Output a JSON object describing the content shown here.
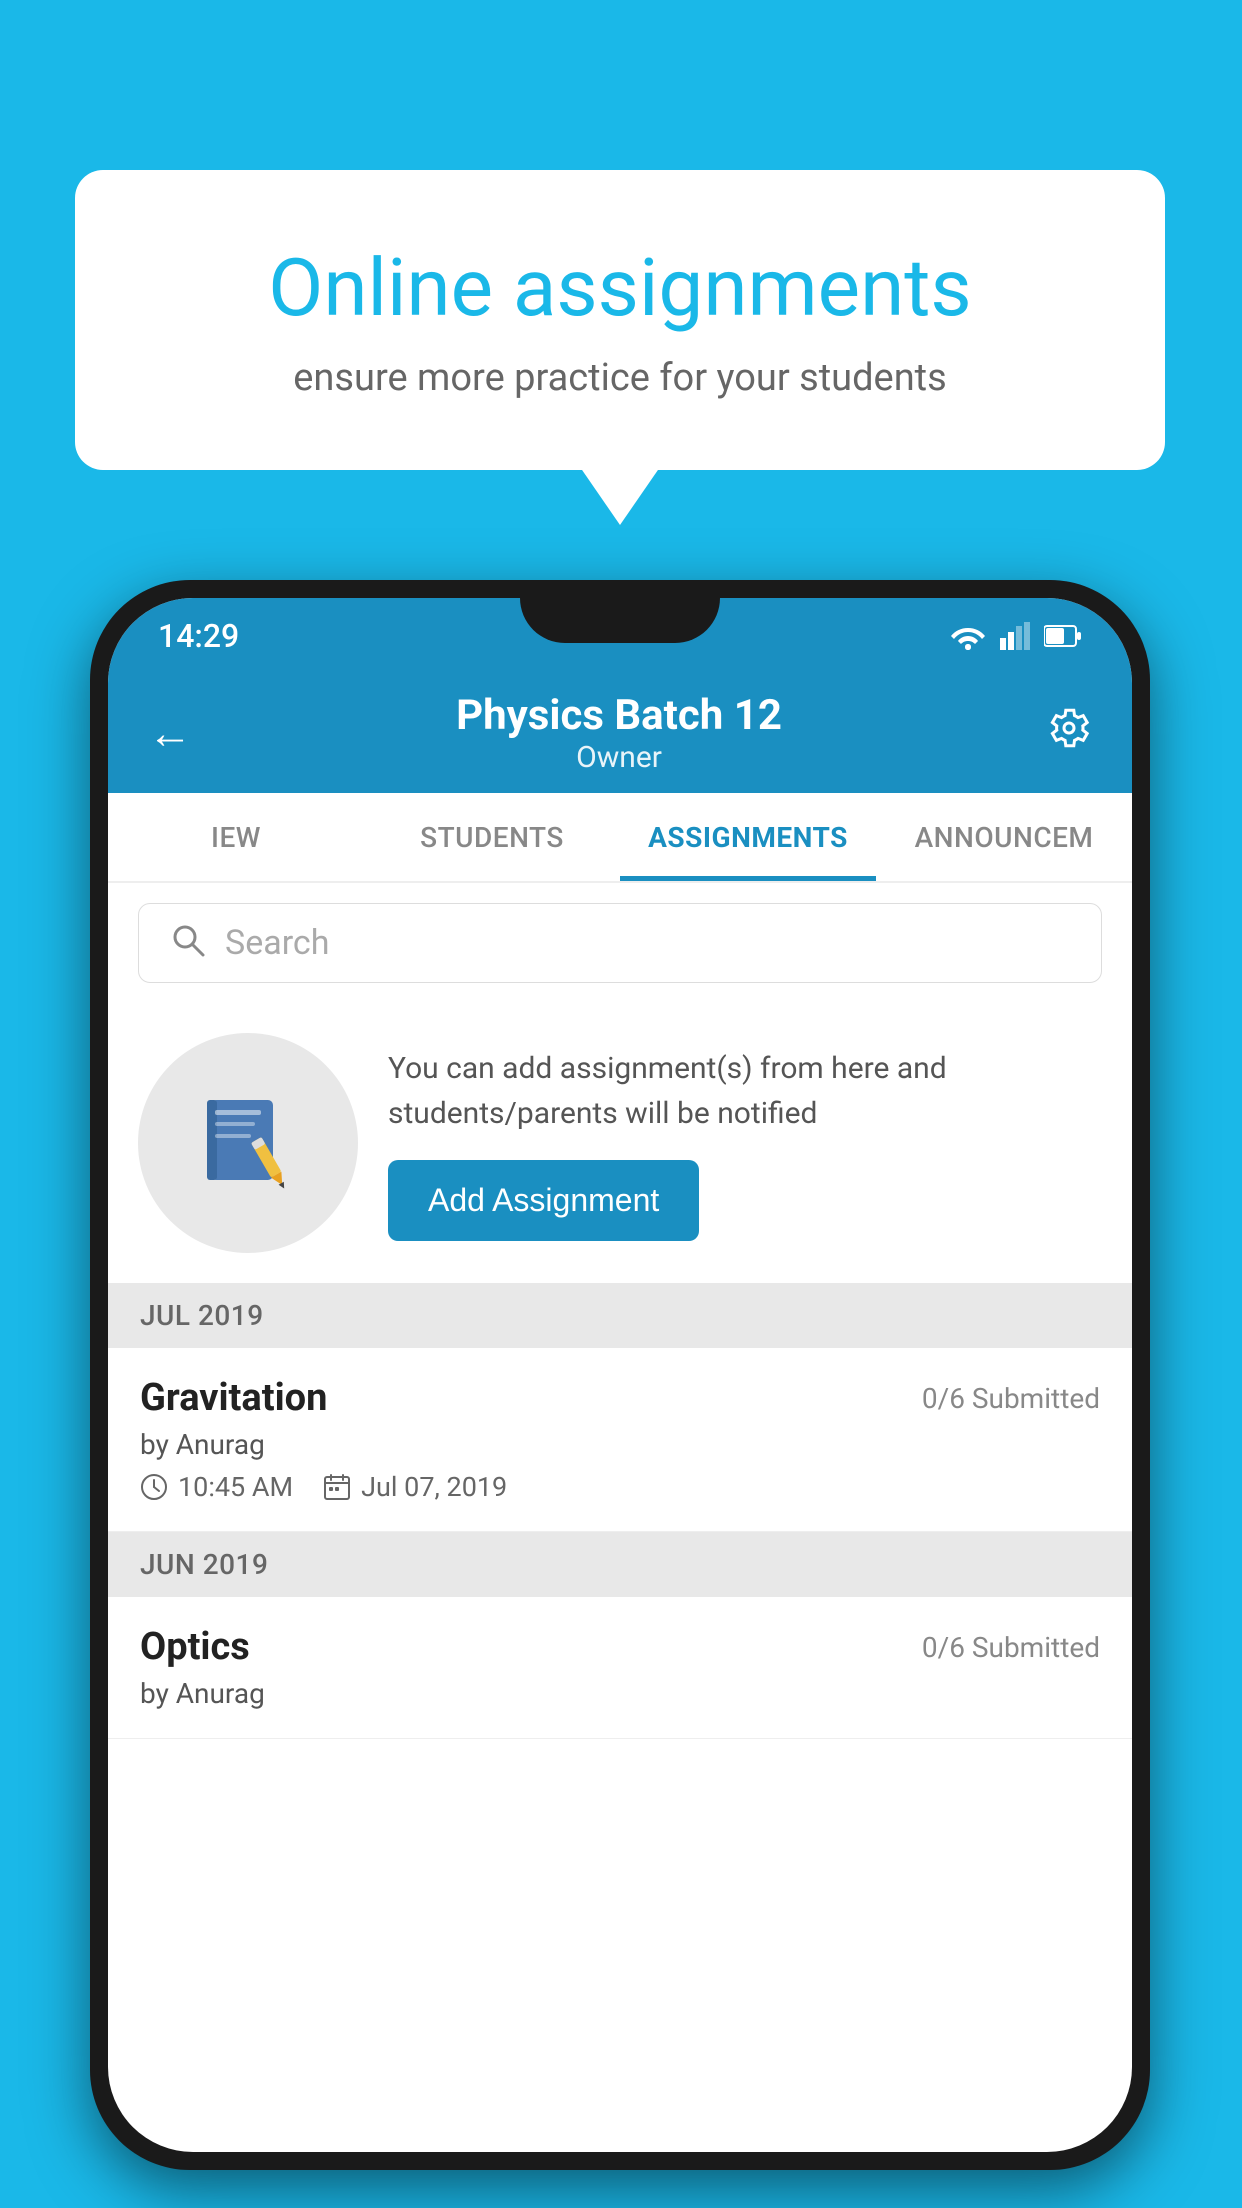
{
  "background_color": "#1ab8e8",
  "speech_bubble": {
    "title": "Online assignments",
    "subtitle": "ensure more practice for your students"
  },
  "status_bar": {
    "time": "14:29"
  },
  "header": {
    "title": "Physics Batch 12",
    "subtitle": "Owner"
  },
  "tabs": [
    {
      "label": "IEW",
      "active": false
    },
    {
      "label": "STUDENTS",
      "active": false
    },
    {
      "label": "ASSIGNMENTS",
      "active": true
    },
    {
      "label": "ANNOUNCEM",
      "active": false
    }
  ],
  "search": {
    "placeholder": "Search"
  },
  "promo": {
    "text": "You can add assignment(s) from here and students/parents will be notified",
    "button_label": "Add Assignment"
  },
  "sections": [
    {
      "label": "JUL 2019",
      "assignments": [
        {
          "name": "Gravitation",
          "submitted": "0/6 Submitted",
          "by": "by Anurag",
          "time": "10:45 AM",
          "date": "Jul 07, 2019"
        }
      ]
    },
    {
      "label": "JUN 2019",
      "assignments": [
        {
          "name": "Optics",
          "submitted": "0/6 Submitted",
          "by": "by Anurag",
          "time": "",
          "date": ""
        }
      ]
    }
  ]
}
